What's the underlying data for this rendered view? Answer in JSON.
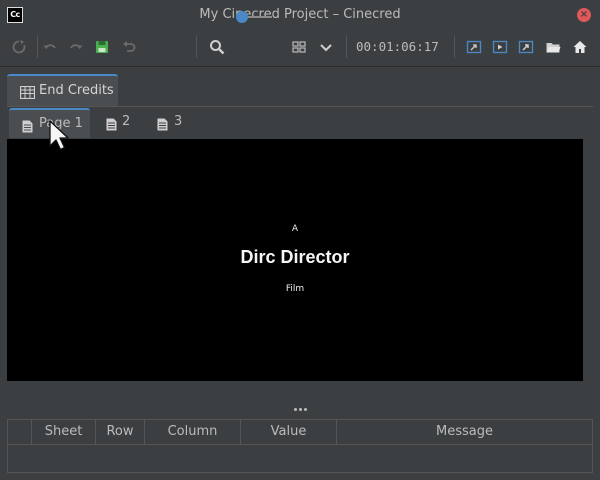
{
  "window": {
    "title": "My Cinecred Project – Cinecred",
    "logo_text": "Cc",
    "close_glyph": "×"
  },
  "toolbar": {
    "icons": [
      "reset-icon",
      "undo-icon",
      "redo-icon",
      "save-icon",
      "revert-icon",
      "zoom-icon",
      "layout-grid-icon",
      "chevron-down-icon",
      "export-image-icon",
      "play-video-icon",
      "export-video-icon",
      "open-folder-icon",
      "home-icon"
    ],
    "zoom_level": 0.0,
    "timecode": "00:01:06:17",
    "save_color": "#4caf50",
    "accent_color": "#4a88c7"
  },
  "outer_tab": {
    "label": "End Credits"
  },
  "pages": [
    {
      "label": "Page 1",
      "selected": true
    },
    {
      "label": "2",
      "selected": false
    },
    {
      "label": "3",
      "selected": false
    }
  ],
  "preview": {
    "line_a": "A",
    "line_name": "Dirc Director",
    "line_film": "Film"
  },
  "table": {
    "columns": [
      "",
      "Sheet",
      "Row",
      "Column",
      "Value",
      "Message"
    ]
  }
}
